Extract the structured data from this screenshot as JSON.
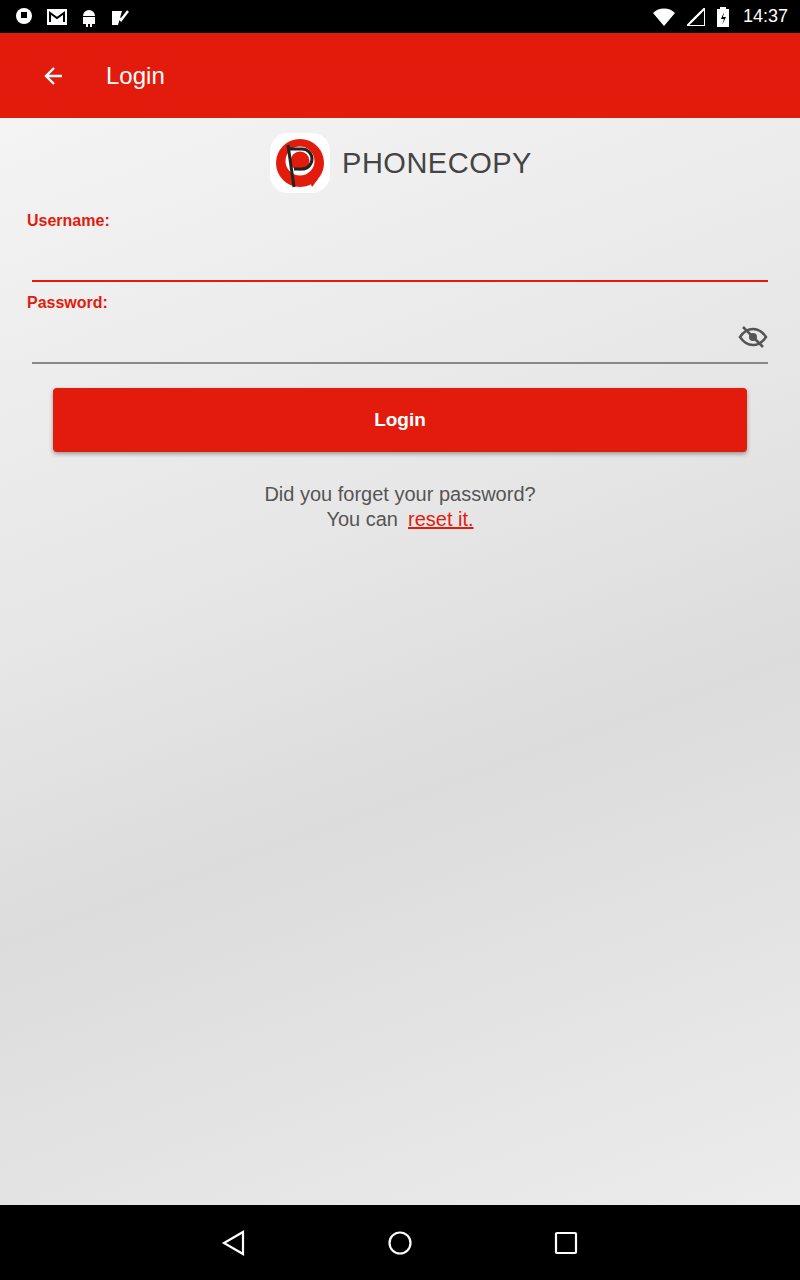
{
  "status_bar": {
    "time": "14:37"
  },
  "app_bar": {
    "title": "Login"
  },
  "logo": {
    "text": "PHONECOPY"
  },
  "fields": [
    {
      "label": "Username:",
      "value": "",
      "focused": true,
      "password": false,
      "visible": false
    },
    {
      "label": "Password:",
      "value": "",
      "focused": false,
      "password": true,
      "visible": false
    }
  ],
  "login_button": "Login",
  "help": {
    "question": "Did you forget your password?",
    "prefix": "You can",
    "link": "reset it."
  }
}
